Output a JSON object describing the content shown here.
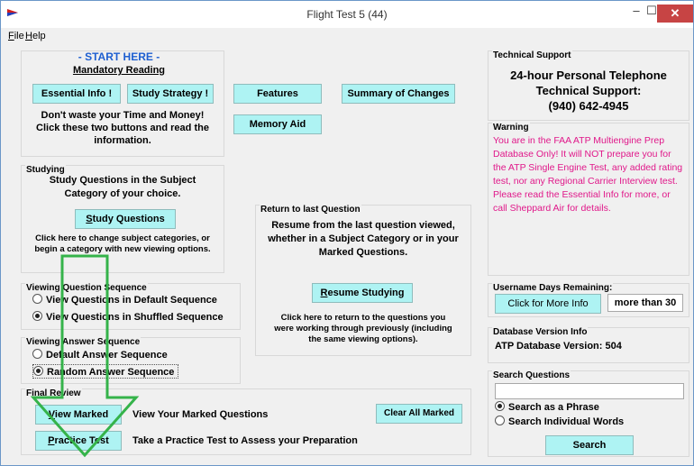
{
  "window": {
    "title": "Flight Test 5 (44)",
    "min": "–",
    "max": "☐",
    "close": "✕"
  },
  "menu": {
    "file": "File",
    "help": "Help"
  },
  "start": {
    "heading": "- START HERE -",
    "mandatory": "Mandatory Reading",
    "essential_btn": "Essential Info !",
    "strategy_btn": "Study Strategy !",
    "note_line1": "Don't waste your Time and Money!",
    "note_line2": "Click these two buttons and read the",
    "note_line3": "information."
  },
  "features_btn": "Features",
  "summary_btn": "Summary of Changes",
  "memory_btn": "Memory Aid",
  "studying": {
    "label": "Studying",
    "line1": "Study Questions in the Subject",
    "line2": "Category of your choice.",
    "button": "Study Questions",
    "hint1": "Click here to change subject categories, or",
    "hint2": "begin a category with new viewing options."
  },
  "return": {
    "label": "Return to last Question",
    "line1": "Resume from the last question viewed,",
    "line2": "whether in a Subject Category or in your",
    "line3": "Marked Questions.",
    "button": "Resume Studying",
    "hint1": "Click here to return to the questions you",
    "hint2": "were working through previously (including",
    "hint3": "the same viewing options)."
  },
  "question_sequence": {
    "label": "Viewing Question Sequence",
    "option1": "View Questions in Default Sequence",
    "option2": "View Questions in Shuffled Sequence"
  },
  "answer_sequence": {
    "label": "Viewing Answer Sequence",
    "option1": "Default Answer Sequence",
    "option2": "Random Answer Sequence"
  },
  "final_review": {
    "label": "Final Review",
    "view_marked_btn": "View Marked",
    "view_marked_text": "View Your Marked Questions",
    "clear_btn": "Clear All Marked",
    "practice_btn": "Practice Test",
    "practice_text": "Take a Practice Test to Assess your Preparation"
  },
  "support": {
    "label": "Technical Support",
    "line1": "24-hour Personal Telephone",
    "line2": "Technical Support:",
    "phone": "(940) 642-4945"
  },
  "warning": {
    "label": "Warning",
    "text": "You are in the FAA ATP Multiengine Prep Database Only!  It will NOT prepare you for the ATP Single Engine Test, any added rating test, nor any Regional Carrier Interview test.  Please read the Essential Info for more, or call Sheppard Air for details."
  },
  "username": {
    "label": "Username Days Remaining:",
    "button": "Click for More Info",
    "value": "more than 30"
  },
  "database": {
    "label": "Database Version Info",
    "text": "ATP Database Version:  504"
  },
  "search": {
    "label": "Search Questions",
    "input_value": "",
    "option1": "Search as a Phrase",
    "option2": "Search Individual Words",
    "button": "Search"
  },
  "colors": {
    "button": "#aef3f3",
    "warning": "#e0188a",
    "heading": "#1e5fd0",
    "arrow": "#35b34a"
  }
}
